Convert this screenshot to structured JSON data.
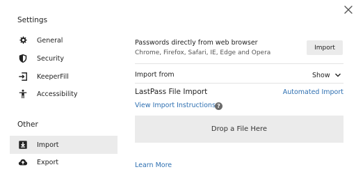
{
  "close_icon": "close-icon",
  "sidebar": {
    "settings_heading": "Settings",
    "settings_items": [
      {
        "label": "General",
        "icon": "gear-icon"
      },
      {
        "label": "Security",
        "icon": "shield-icon"
      },
      {
        "label": "KeeperFill",
        "icon": "sign-in-icon"
      },
      {
        "label": "Accessibility",
        "icon": "accessibility-icon"
      }
    ],
    "other_heading": "Other",
    "other_items": [
      {
        "label": "Import",
        "icon": "import-icon",
        "active": true
      },
      {
        "label": "Export",
        "icon": "cloud-upload-icon",
        "active": false
      }
    ]
  },
  "main": {
    "browser_import": {
      "title": "Passwords directly from web browser",
      "subtitle": "Chrome, Firefox, Safari, IE, Edge and Opera",
      "button_label": "Import"
    },
    "import_from": {
      "label": "Import from",
      "toggle_label": "Show"
    },
    "file_import": {
      "title": "LastPass File Import",
      "automated_link": "Automated Import",
      "instructions_link": "View Import Instructions",
      "help_symbol": "?",
      "drop_label": "Drop a File Here"
    },
    "learn_more_link": "Learn More"
  },
  "colors": {
    "link": "#2d6fb1",
    "active_background": "#ebebeb",
    "button_background": "#ebebeb"
  }
}
